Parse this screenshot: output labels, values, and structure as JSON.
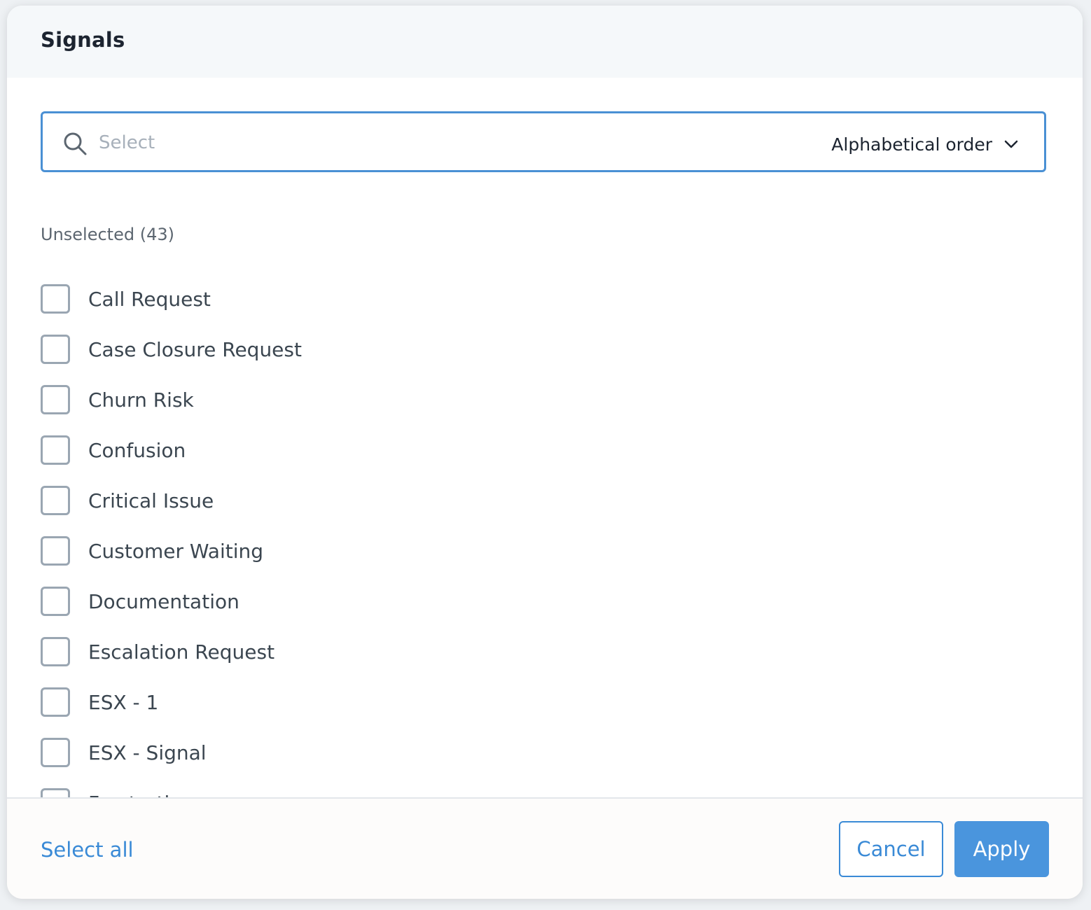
{
  "modal": {
    "title": "Signals"
  },
  "search": {
    "placeholder": "Select",
    "value": "",
    "sort_selected": "Alphabetical order"
  },
  "list": {
    "section_label": "Unselected (43)",
    "items": [
      {
        "label": "Call Request",
        "checked": false
      },
      {
        "label": "Case Closure Request",
        "checked": false
      },
      {
        "label": "Churn Risk",
        "checked": false
      },
      {
        "label": "Confusion",
        "checked": false
      },
      {
        "label": "Critical Issue",
        "checked": false
      },
      {
        "label": "Customer Waiting",
        "checked": false
      },
      {
        "label": "Documentation",
        "checked": false
      },
      {
        "label": "Escalation Request",
        "checked": false
      },
      {
        "label": "ESX - 1",
        "checked": false
      },
      {
        "label": "ESX - Signal",
        "checked": false
      },
      {
        "label": "Frustration",
        "checked": false
      }
    ]
  },
  "footer": {
    "select_all_label": "Select all",
    "cancel_label": "Cancel",
    "apply_label": "Apply"
  },
  "colors": {
    "accent": "#3a8ad6",
    "primary_button": "#4a95dd",
    "header_bg": "#f5f8fa",
    "checkbox_border": "#9aa6b2"
  },
  "icons": {
    "search": "search-icon",
    "sort": "chevron-down-icon"
  }
}
